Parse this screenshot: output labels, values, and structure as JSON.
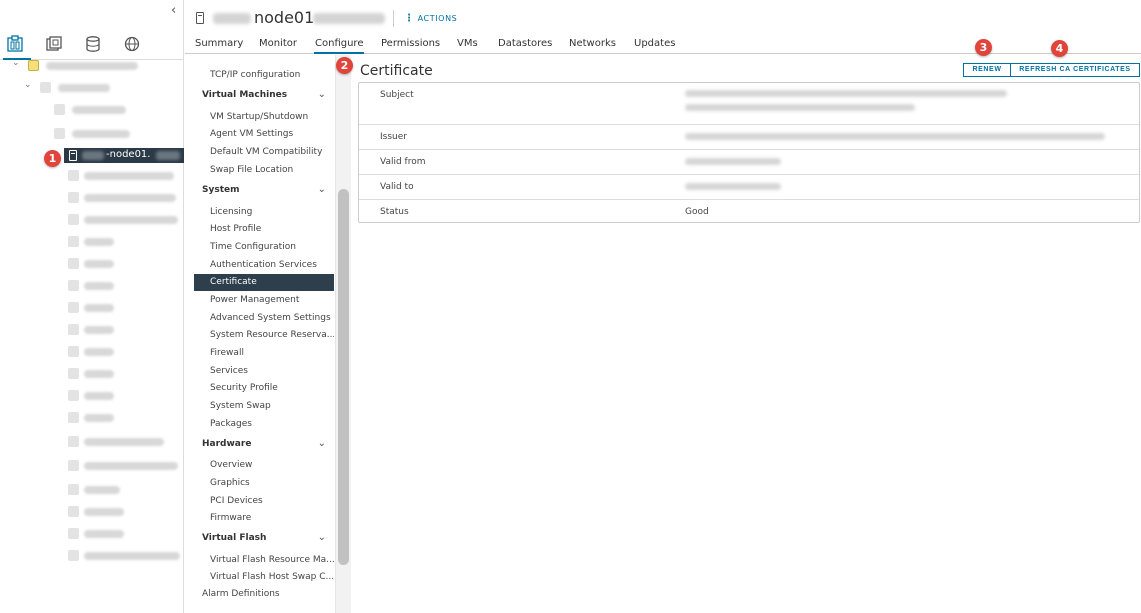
{
  "header": {
    "title": "node01",
    "actions_label": "ACTIONS"
  },
  "tree": {
    "selected_host_label": "-node01."
  },
  "tabs": [
    {
      "label": "Summary"
    },
    {
      "label": "Monitor"
    },
    {
      "label": "Configure"
    },
    {
      "label": "Permissions"
    },
    {
      "label": "VMs"
    },
    {
      "label": "Datastores"
    },
    {
      "label": "Networks"
    },
    {
      "label": "Updates"
    }
  ],
  "nav": {
    "tcpip": "TCP/IP configuration",
    "groups": {
      "virtual_machines": "Virtual Machines",
      "system": "System",
      "hardware": "Hardware",
      "virtual_flash": "Virtual Flash"
    },
    "vm_items": [
      "VM Startup/Shutdown",
      "Agent VM Settings",
      "Default VM Compatibility",
      "Swap File Location"
    ],
    "system_items": [
      "Licensing",
      "Host Profile",
      "Time Configuration",
      "Authentication Services",
      "Certificate",
      "Power Management",
      "Advanced System Settings",
      "System Resource Reserva...",
      "Firewall",
      "Services",
      "Security Profile",
      "System Swap",
      "Packages"
    ],
    "hardware_items": [
      "Overview",
      "Graphics",
      "PCI Devices",
      "Firmware"
    ],
    "flash_items": [
      "Virtual Flash Resource Ma...",
      "Virtual Flash Host Swap C..."
    ],
    "alarm_definitions": "Alarm Definitions"
  },
  "certificate": {
    "title": "Certificate",
    "renew_label": "RENEW",
    "refresh_label": "REFRESH CA CERTIFICATES",
    "rows": [
      {
        "label": "Subject"
      },
      {
        "label": "Issuer"
      },
      {
        "label": "Valid from"
      },
      {
        "label": "Valid to"
      },
      {
        "label": "Status",
        "value": "Good"
      }
    ]
  },
  "callouts": [
    "1",
    "2",
    "3",
    "4"
  ],
  "colors": {
    "accent": "#0072a3",
    "selected_nav": "#2d3e4c",
    "callout": "#e0443b"
  }
}
